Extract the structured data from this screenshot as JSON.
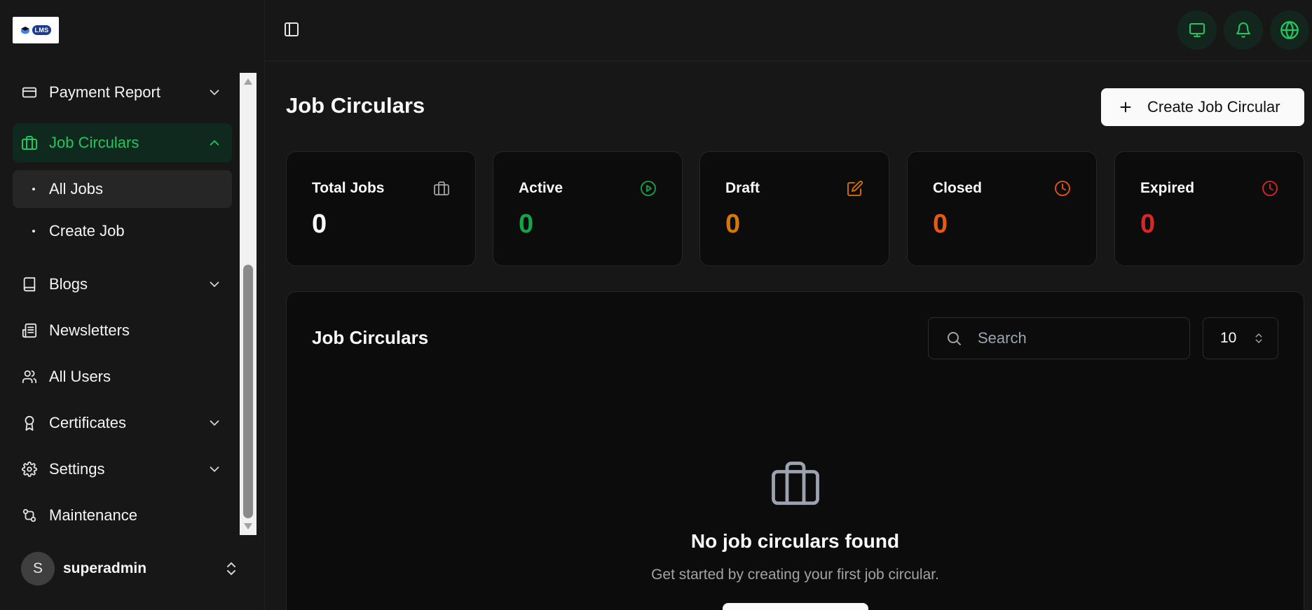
{
  "logo": {
    "text": "LMS"
  },
  "sidebar": {
    "items": [
      {
        "label": "Payment Report"
      },
      {
        "label": "Job Circulars"
      },
      {
        "label": "Blogs"
      },
      {
        "label": "Newsletters"
      },
      {
        "label": "All Users"
      },
      {
        "label": "Certificates"
      },
      {
        "label": "Settings"
      },
      {
        "label": "Maintenance"
      }
    ],
    "job_circulars_sub": [
      {
        "label": "All Jobs"
      },
      {
        "label": "Create Job"
      }
    ],
    "user": {
      "initial": "S",
      "name": "superadmin"
    }
  },
  "topbar": {
    "icons": [
      "panel-toggle-icon",
      "monitor-icon",
      "bell-icon",
      "globe-icon"
    ]
  },
  "main": {
    "title": "Job Circulars",
    "create_button": "Create Job Circular",
    "stats": [
      {
        "label": "Total Jobs",
        "value": "0",
        "color": "#fafafa",
        "icon": "briefcase-icon"
      },
      {
        "label": "Active",
        "value": "0",
        "color": "#16a34a",
        "icon": "play-circle-icon"
      },
      {
        "label": "Draft",
        "value": "0",
        "color": "#d97706",
        "icon": "edit-icon"
      },
      {
        "label": "Closed",
        "value": "0",
        "color": "#ea580c",
        "icon": "clock-icon"
      },
      {
        "label": "Expired",
        "value": "0",
        "color": "#dc2626",
        "icon": "clock-icon"
      }
    ],
    "table": {
      "title": "Job Circulars",
      "search_placeholder": "Search",
      "page_size": "10",
      "empty_title": "No job circulars found",
      "empty_subtitle": "Get started by creating your first job circular."
    }
  },
  "colors": {
    "accent": "#22c55e",
    "background": "#171717",
    "card": "#0c0c0c"
  }
}
